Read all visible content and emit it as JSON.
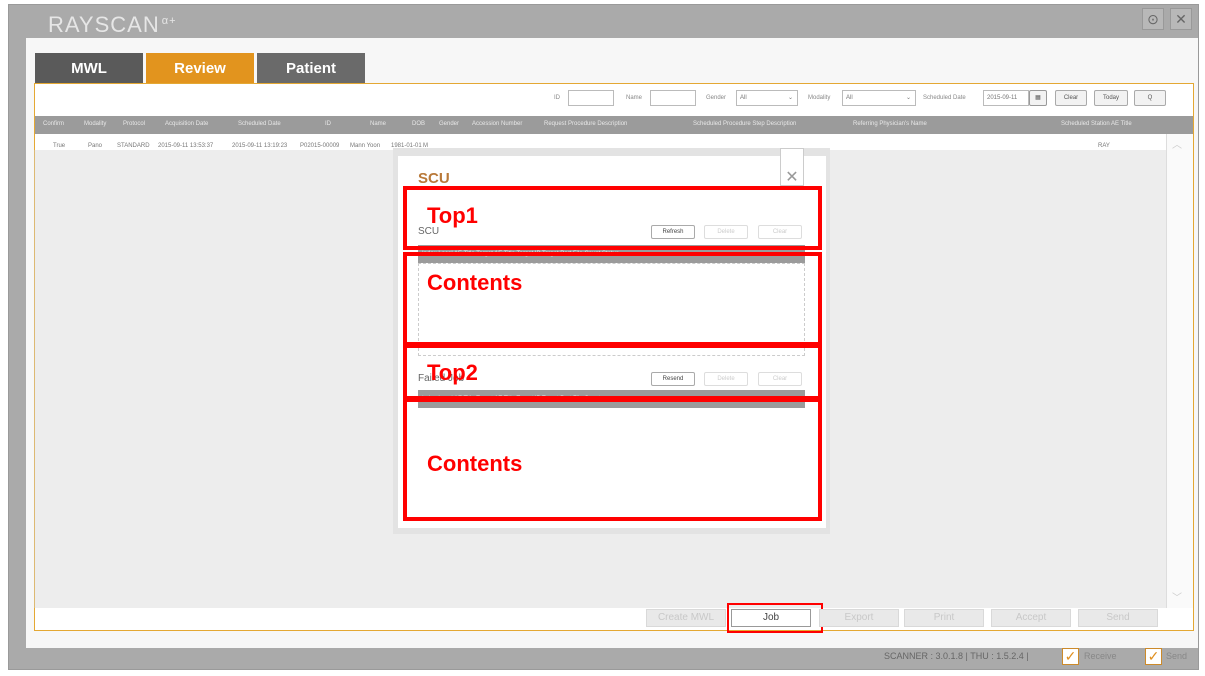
{
  "app": {
    "logo": "RAYSCAN",
    "logo_mark": "α+",
    "gear_glyph": "⊙",
    "close_glyph": "✕"
  },
  "tabs": [
    {
      "label": "MWL",
      "active": false,
      "color": "#5a5a5a"
    },
    {
      "label": "Review",
      "active": true,
      "color": "#e2941e"
    },
    {
      "label": "Patient",
      "active": false,
      "color": "#6a6a6a"
    }
  ],
  "filters": {
    "id_label": "ID",
    "name_label": "Name",
    "gender_label": "Gender",
    "gender_value": "All",
    "modality_label": "Modality",
    "modality_value": "All",
    "scheduled_date_label": "Scheduled Date",
    "scheduled_date_value": "2015-09-11",
    "clear": "Clear",
    "today": "Today",
    "search_glyph": "Q"
  },
  "table": {
    "columns": [
      "Confirm",
      "Modality",
      "Protocol",
      "Acquisition Date",
      "Scheduled Date",
      "ID",
      "Name",
      "DOB",
      "Gender",
      "Accession Number",
      "Request Procedure Description",
      "Scheduled Procedure Step Description",
      "Referring Physician's Name",
      "Scheduled Station AE Title"
    ],
    "rows": [
      {
        "confirm": "True",
        "modality": "Pano",
        "protocol": "STANDARD",
        "acq_date": "2015-09-11 13:53:37",
        "sched_date": "2015-09-11 13:19:23",
        "id": "P02015-00009",
        "name": "Mann Yoon",
        "dob": "1981-01-01",
        "gender": "M",
        "ae": "RAY"
      }
    ]
  },
  "bottom_buttons": [
    "Create MWL",
    "Job",
    "Export",
    "Print",
    "Accept",
    "Send"
  ],
  "dialog": {
    "title": "SCU",
    "close_glyph": "✕",
    "section1": {
      "label": "SCU",
      "buttons": [
        "Refresh",
        "Delete",
        "Clear"
      ],
      "columns": "Index    Local AE Title    Target AE Title    Target IP    Target Port    File Count    Status"
    },
    "section2": {
      "label": "Failed Job",
      "buttons": [
        "Resend",
        "Delete",
        "Clear"
      ],
      "columns": "Index    Local AE Title    Target AE Title    Target IP    Target Port    File Count"
    }
  },
  "annotations": {
    "top1": "Top1",
    "contents1": "Contents",
    "top2": "Top2",
    "contents2": "Contents"
  },
  "status_bar": {
    "version": "SCANNER : 3.0.1.8 | THU : 1.5.2.4 |",
    "receive": "Receive",
    "send": "Send",
    "check_glyph": "✓"
  },
  "colors": {
    "accent": "#e2941e",
    "annotation": "#ff0000",
    "header": "#9b9b9b"
  }
}
